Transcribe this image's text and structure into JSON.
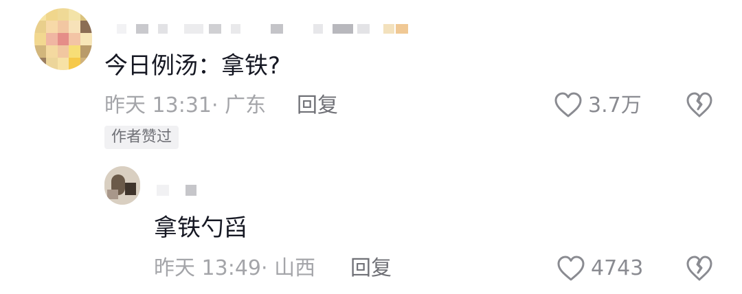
{
  "comment": {
    "text": "今日例汤：拿铁?",
    "time": "昨天 13:31",
    "location_sep": "·",
    "location": "广东",
    "reply_label": "回复",
    "likes": "3.7万",
    "badge": "作者赞过"
  },
  "reply": {
    "text": "拿铁勺舀",
    "time": "昨天 13:49",
    "location_sep": "·",
    "location": "山西",
    "reply_label": "回复",
    "likes": "4743"
  },
  "icons": {
    "like": "heart-outline-icon",
    "dislike": "broken-heart-icon"
  }
}
